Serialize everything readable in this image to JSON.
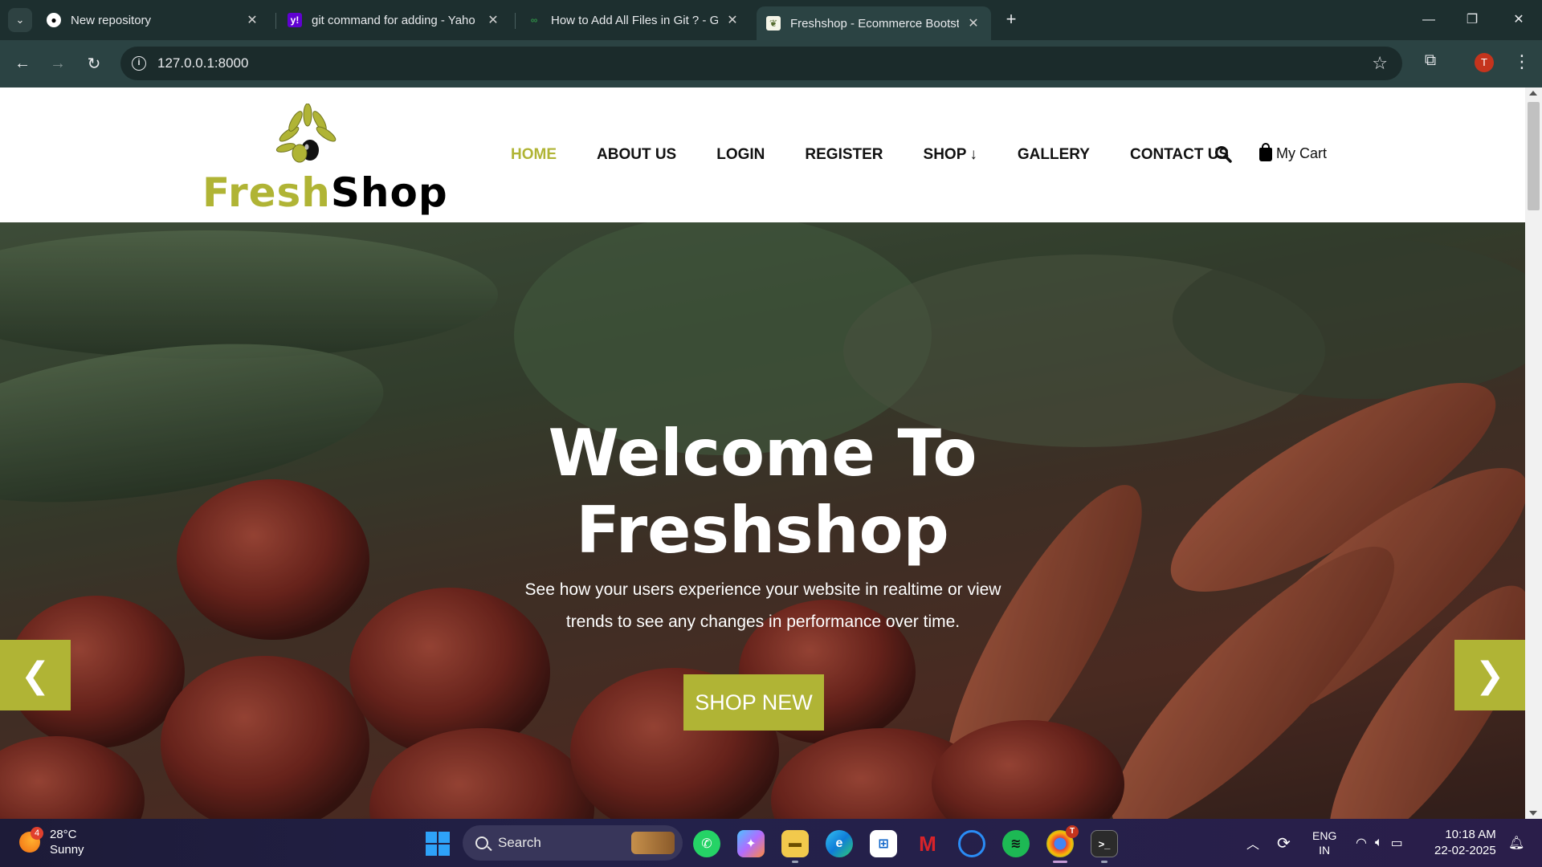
{
  "browser": {
    "tabs": [
      {
        "title": "New repository",
        "icon": "github-icon"
      },
      {
        "title": "git command for adding - Yaho",
        "icon": "yahoo-icon"
      },
      {
        "title": "How to Add All Files in Git ? - G",
        "icon": "geeksforgeeks-icon"
      },
      {
        "title": "Freshshop - Ecommerce Bootst",
        "icon": "freshshop-favicon",
        "active": true
      }
    ],
    "url": "127.0.0.1:8000",
    "profile_initial": "T"
  },
  "site": {
    "logo": {
      "part1": "Fresh",
      "part2": "Shop",
      "accent": "#b0b435"
    },
    "nav": [
      {
        "label": "HOME",
        "active": true
      },
      {
        "label": "ABOUT US"
      },
      {
        "label": "LOGIN"
      },
      {
        "label": "REGISTER"
      },
      {
        "label": "SHOP"
      },
      {
        "label": "GALLERY"
      },
      {
        "label": "CONTACT US"
      }
    ],
    "cart_label": "My Cart",
    "hero": {
      "title_line1": "Welcome To",
      "title_line2": "Freshshop",
      "subtitle_line1": "See how your users experience your website in realtime or view",
      "subtitle_line2": "trends to see any changes in performance over time.",
      "button": "SHOP NEW"
    }
  },
  "taskbar": {
    "weather": {
      "temp": "28°C",
      "condition": "Sunny",
      "badge": "4"
    },
    "search_label": "Search",
    "lang": {
      "line1": "ENG",
      "line2": "IN"
    },
    "time": "10:18 AM",
    "date": "22-02-2025",
    "chrome_badge": "T"
  }
}
